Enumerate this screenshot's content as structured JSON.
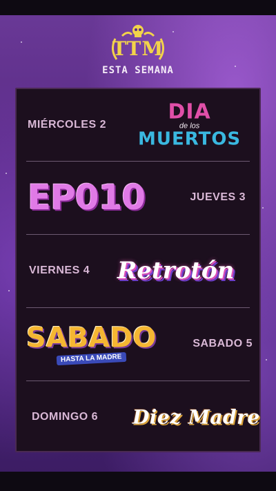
{
  "header": {
    "logo_text": "TTM",
    "tagline": "ESTA SEMANA"
  },
  "schedule": [
    {
      "day": "MIÉRCOLES 2",
      "show": {
        "line1": "DIA",
        "line2": "de los",
        "line3": "MUERTOS"
      }
    },
    {
      "day": "JUEVES 3",
      "show": {
        "line1": "EP010"
      }
    },
    {
      "day": "VIERNES 4",
      "show": {
        "line1": "Retrotón"
      }
    },
    {
      "day": "SABADO 5",
      "show": {
        "line1": "SABADO",
        "line2": "HASTA LA MADRE"
      }
    },
    {
      "day": "DOMINGO 6",
      "show": {
        "line1": "Diez Madre"
      }
    }
  ],
  "colors": {
    "gold": "#f2d34a",
    "day_text": "#d9b8d6",
    "panel": "#1c0f1e"
  }
}
